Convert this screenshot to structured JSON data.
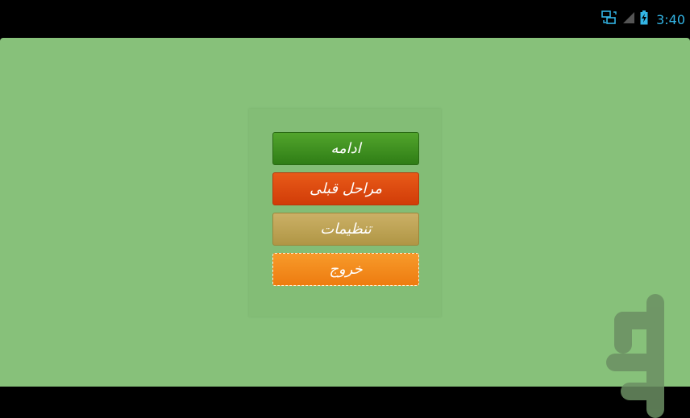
{
  "status_bar": {
    "time": "3:40",
    "icons": [
      "network-sync-icon",
      "signal-icon",
      "battery-charging-icon"
    ]
  },
  "menu": {
    "continue_label": "ادامه",
    "previous_levels_label": "مراحل قبلی",
    "settings_label": "تنظیمات",
    "exit_label": "خروج"
  },
  "colors": {
    "background": "#87c17a",
    "continue": "#3f9120",
    "previous_levels": "#dc4a0f",
    "settings": "#bfa455",
    "exit": "#f38b1d",
    "status_accent": "#33b5e5"
  }
}
